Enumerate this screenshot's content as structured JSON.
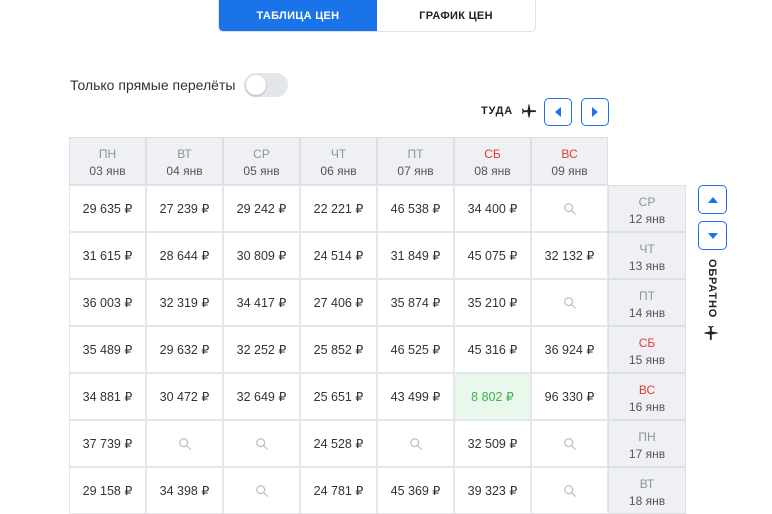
{
  "tabs": [
    {
      "label": "ТАБЛИЦА ЦЕН",
      "active": true
    },
    {
      "label": "ГРАФИК ЦЕН",
      "active": false
    }
  ],
  "direct_only": {
    "label": "Только прямые перелёты",
    "on": false
  },
  "outbound": {
    "label": "ТУДА"
  },
  "return": {
    "label": "ОБРАТНО"
  },
  "colors": {
    "accent": "#1a73e8",
    "weekend": "#e53935",
    "best_price": "#3cb34a",
    "best_bg": "#e9f7ec"
  },
  "columns": [
    {
      "day": "ПН",
      "date": "03 янв",
      "weekend": false
    },
    {
      "day": "ВТ",
      "date": "04 янв",
      "weekend": false
    },
    {
      "day": "СР",
      "date": "05 янв",
      "weekend": false
    },
    {
      "day": "ЧТ",
      "date": "06 янв",
      "weekend": false
    },
    {
      "day": "ПТ",
      "date": "07 янв",
      "weekend": false
    },
    {
      "day": "СБ",
      "date": "08 янв",
      "weekend": true
    },
    {
      "day": "ВС",
      "date": "09 янв",
      "weekend": true
    }
  ],
  "rows": [
    {
      "day": "СР",
      "date": "12 янв",
      "weekend": false,
      "prices": [
        "29 635 ₽",
        "27 239 ₽",
        "29 242 ₽",
        "22 221 ₽",
        "46 538 ₽",
        "34 400 ₽",
        null
      ]
    },
    {
      "day": "ЧТ",
      "date": "13 янв",
      "weekend": false,
      "prices": [
        "31 615 ₽",
        "28 644 ₽",
        "30 809 ₽",
        "24 514 ₽",
        "31 849 ₽",
        "45 075 ₽",
        "32 132 ₽"
      ]
    },
    {
      "day": "ПТ",
      "date": "14 янв",
      "weekend": false,
      "prices": [
        "36 003 ₽",
        "32 319 ₽",
        "34 417 ₽",
        "27 406 ₽",
        "35 874 ₽",
        "35 210 ₽",
        null
      ]
    },
    {
      "day": "СБ",
      "date": "15 янв",
      "weekend": true,
      "prices": [
        "35 489 ₽",
        "29 632 ₽",
        "32 252 ₽",
        "25 852 ₽",
        "46 525 ₽",
        "45 316 ₽",
        "36 924 ₽"
      ]
    },
    {
      "day": "ВС",
      "date": "16 янв",
      "weekend": true,
      "prices": [
        "34 881 ₽",
        "30 472 ₽",
        "32 649 ₽",
        "25 651 ₽",
        "43 499 ₽",
        "8 802 ₽",
        "96 330 ₽"
      ],
      "best_index": 5
    },
    {
      "day": "ПН",
      "date": "17 янв",
      "weekend": false,
      "prices": [
        "37 739 ₽",
        null,
        null,
        "24 528 ₽",
        null,
        "32 509 ₽",
        null
      ]
    },
    {
      "day": "ВТ",
      "date": "18 янв",
      "weekend": false,
      "prices": [
        "29 158 ₽",
        "34 398 ₽",
        null,
        "24 781 ₽",
        "45 369 ₽",
        "39 323 ₽",
        null
      ]
    }
  ]
}
